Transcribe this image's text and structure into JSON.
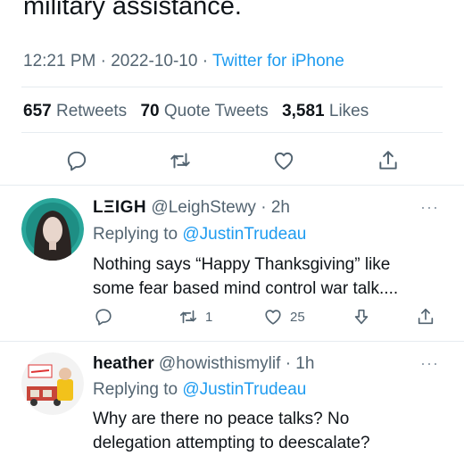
{
  "tweet": {
    "text_tail": "military assistance.",
    "time": "12:21 PM",
    "date": "2022-10-10",
    "source": "Twitter for iPhone",
    "dot": "·",
    "retweets_count": "657",
    "retweets_label": "Retweets",
    "quotes_count": "70",
    "quotes_label": "Quote Tweets",
    "likes_count": "3,581",
    "likes_label": "Likes"
  },
  "replies": [
    {
      "name": "LΞIGH",
      "handle": "@LeighStewy",
      "time": "2h",
      "replying_prefix": "Replying to",
      "replying_to": "@JustinTrudeau",
      "lines": [
        "Nothing says “Happy Thanksgiving” like",
        "some fear based mind control war talk...."
      ],
      "retweet_count": "1",
      "like_count": "25"
    },
    {
      "name": "heather",
      "handle": "@howisthismylif",
      "time": "1h",
      "replying_prefix": "Replying to",
      "replying_to": "@JustinTrudeau",
      "lines": [
        "Why are there no peace talks? No",
        "delegation attempting to deescalate?"
      ]
    }
  ],
  "more_label": "···",
  "icons": {
    "reply": "reply-icon",
    "retweet": "retweet-icon",
    "like": "heart-icon",
    "share": "share-icon",
    "downvote": "downvote-icon"
  },
  "colors": {
    "link": "#1d9bf0",
    "text": "#0f1419",
    "secondary": "#536471",
    "divider": "#e6ecf0"
  }
}
